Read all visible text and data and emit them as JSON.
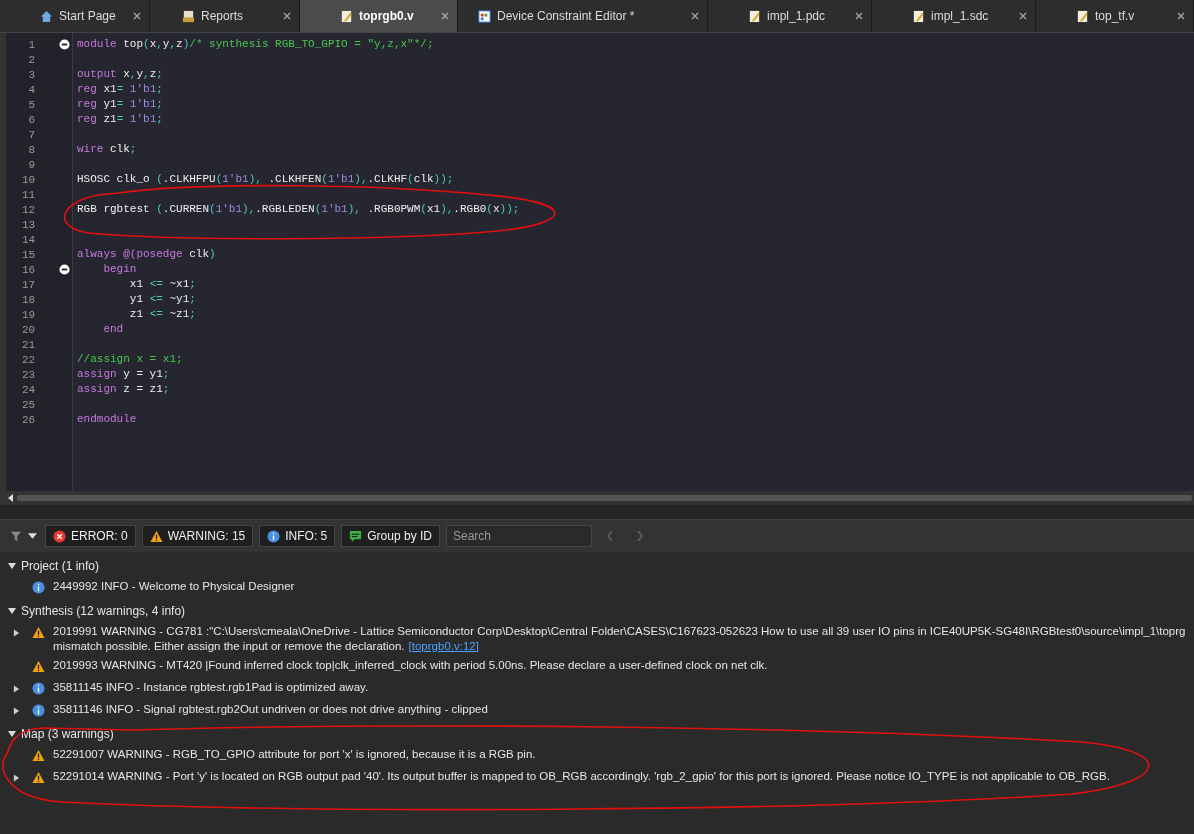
{
  "tabs": [
    {
      "label": "Start Page",
      "selected": false
    },
    {
      "label": "Reports",
      "selected": false
    },
    {
      "label": "toprgb0.v",
      "selected": true
    },
    {
      "label": "Device Constraint Editor *",
      "selected": false
    },
    {
      "label": "impl_1.pdc",
      "selected": false
    },
    {
      "label": "impl_1.sdc",
      "selected": false
    },
    {
      "label": "top_tf.v",
      "selected": false
    }
  ],
  "editor": {
    "lines": [
      {
        "number": "1",
        "fold": true,
        "tokens": [
          {
            "kind": "kw",
            "text": "module"
          },
          {
            "kind": "id",
            "text": " top"
          },
          {
            "kind": "op",
            "text": "("
          },
          {
            "kind": "id",
            "text": "x"
          },
          {
            "kind": "op",
            "text": ","
          },
          {
            "kind": "id",
            "text": "y"
          },
          {
            "kind": "op",
            "text": ","
          },
          {
            "kind": "id",
            "text": "z"
          },
          {
            "kind": "op",
            "text": ")"
          },
          {
            "kind": "cm",
            "text": "/* synthesis RGB_TO_GPIO = \"y,z,x\"*/;"
          }
        ]
      },
      {
        "number": "2",
        "fold": false
      },
      {
        "number": "3",
        "fold": false,
        "tokens": [
          {
            "kind": "kw",
            "text": "output"
          },
          {
            "kind": "id",
            "text": " x"
          },
          {
            "kind": "op",
            "text": ","
          },
          {
            "kind": "id",
            "text": "y"
          },
          {
            "kind": "op",
            "text": ","
          },
          {
            "kind": "id",
            "text": "z"
          },
          {
            "kind": "op",
            "text": ";"
          }
        ]
      },
      {
        "number": "4",
        "fold": false,
        "tokens": [
          {
            "kind": "kw",
            "text": "reg"
          },
          {
            "kind": "id",
            "text": " x1"
          },
          {
            "kind": "op",
            "text": "="
          },
          {
            "kind": "num",
            "text": " 1'b1"
          },
          {
            "kind": "op",
            "text": ";"
          }
        ]
      },
      {
        "number": "5",
        "fold": false,
        "tokens": [
          {
            "kind": "kw",
            "text": "reg"
          },
          {
            "kind": "id",
            "text": " y1"
          },
          {
            "kind": "op",
            "text": "="
          },
          {
            "kind": "num",
            "text": " 1'b1"
          },
          {
            "kind": "op",
            "text": ";"
          }
        ]
      },
      {
        "number": "6",
        "fold": false,
        "tokens": [
          {
            "kind": "kw",
            "text": "reg"
          },
          {
            "kind": "id",
            "text": " z1"
          },
          {
            "kind": "op",
            "text": "="
          },
          {
            "kind": "num",
            "text": " 1'b1"
          },
          {
            "kind": "op",
            "text": ";"
          }
        ]
      },
      {
        "number": "7",
        "fold": false
      },
      {
        "number": "8",
        "fold": false,
        "tokens": [
          {
            "kind": "kw",
            "text": "wire"
          },
          {
            "kind": "id",
            "text": " clk"
          },
          {
            "kind": "op",
            "text": ";"
          }
        ]
      },
      {
        "number": "9",
        "fold": false
      },
      {
        "number": "10",
        "fold": false,
        "tokens": [
          {
            "kind": "id",
            "text": "HSOSC clk_o "
          },
          {
            "kind": "op",
            "text": "("
          },
          {
            "kind": "id",
            "text": ".CLKHFPU"
          },
          {
            "kind": "op",
            "text": "("
          },
          {
            "kind": "num",
            "text": "1'b1"
          },
          {
            "kind": "op",
            "text": "),"
          },
          {
            "kind": "id",
            "text": " .CLKHFEN"
          },
          {
            "kind": "op",
            "text": "("
          },
          {
            "kind": "num",
            "text": "1'b1"
          },
          {
            "kind": "op",
            "text": "),"
          },
          {
            "kind": "id",
            "text": ".CLKHF"
          },
          {
            "kind": "op",
            "text": "("
          },
          {
            "kind": "id",
            "text": "clk"
          },
          {
            "kind": "op",
            "text": "));"
          }
        ]
      },
      {
        "number": "11",
        "fold": false
      },
      {
        "number": "12",
        "fold": false,
        "tokens": [
          {
            "kind": "id",
            "text": "RGB rgbtest "
          },
          {
            "kind": "op",
            "text": "("
          },
          {
            "kind": "id",
            "text": ".CURREN"
          },
          {
            "kind": "op",
            "text": "("
          },
          {
            "kind": "num",
            "text": "1'b1"
          },
          {
            "kind": "op",
            "text": "),"
          },
          {
            "kind": "id",
            "text": ".RGBLEDEN"
          },
          {
            "kind": "op",
            "text": "("
          },
          {
            "kind": "num",
            "text": "1'b1"
          },
          {
            "kind": "op",
            "text": "),"
          },
          {
            "kind": "id",
            "text": " .RGB0PWM"
          },
          {
            "kind": "op",
            "text": "("
          },
          {
            "kind": "id",
            "text": "x1"
          },
          {
            "kind": "op",
            "text": "),"
          },
          {
            "kind": "id",
            "text": ".RGB0"
          },
          {
            "kind": "op",
            "text": "("
          },
          {
            "kind": "id",
            "text": "x"
          },
          {
            "kind": "op",
            "text": "));"
          }
        ]
      },
      {
        "number": "13",
        "fold": false
      },
      {
        "number": "14",
        "fold": false
      },
      {
        "number": "15",
        "fold": false,
        "tokens": [
          {
            "kind": "kw",
            "text": "always @(posedge"
          },
          {
            "kind": "id",
            "text": " clk"
          },
          {
            "kind": "op",
            "text": ")"
          }
        ]
      },
      {
        "number": "16",
        "fold": true,
        "tokens": [
          {
            "kind": "kw",
            "text": "    begin"
          }
        ]
      },
      {
        "number": "17",
        "fold": false,
        "tokens": [
          {
            "kind": "id",
            "text": "        x1 "
          },
          {
            "kind": "op",
            "text": "<="
          },
          {
            "kind": "id",
            "text": " ~x1"
          },
          {
            "kind": "op",
            "text": ";"
          }
        ]
      },
      {
        "number": "18",
        "fold": false,
        "tokens": [
          {
            "kind": "id",
            "text": "        y1 "
          },
          {
            "kind": "op",
            "text": "<="
          },
          {
            "kind": "id",
            "text": " ~y1"
          },
          {
            "kind": "op",
            "text": ";"
          }
        ]
      },
      {
        "number": "19",
        "fold": false,
        "tokens": [
          {
            "kind": "id",
            "text": "        z1 "
          },
          {
            "kind": "op",
            "text": "<="
          },
          {
            "kind": "id",
            "text": " ~z1"
          },
          {
            "kind": "op",
            "text": ";"
          }
        ]
      },
      {
        "number": "20",
        "fold": false,
        "tokens": [
          {
            "kind": "kw",
            "text": "    end"
          }
        ]
      },
      {
        "number": "21",
        "fold": false
      },
      {
        "number": "22",
        "fold": false,
        "tokens": [
          {
            "kind": "cm",
            "text": "//assign x = x1;"
          }
        ]
      },
      {
        "number": "23",
        "fold": false,
        "tokens": [
          {
            "kind": "kw",
            "text": "assign"
          },
          {
            "kind": "id",
            "text": " y = y1"
          },
          {
            "kind": "op",
            "text": ";"
          }
        ]
      },
      {
        "number": "24",
        "fold": false,
        "tokens": [
          {
            "kind": "kw",
            "text": "assign"
          },
          {
            "kind": "id",
            "text": " z = z1"
          },
          {
            "kind": "op",
            "text": ";"
          }
        ]
      },
      {
        "number": "25",
        "fold": false
      },
      {
        "number": "26",
        "fold": false,
        "tokens": [
          {
            "kind": "kw",
            "text": "endmodule"
          }
        ]
      }
    ]
  },
  "toolbar": {
    "filters": [
      {
        "kind": "error",
        "label": "ERROR: 0"
      },
      {
        "kind": "warning",
        "label": "WARNING: 15"
      },
      {
        "kind": "info",
        "label": "INFO: 5"
      },
      {
        "kind": "group",
        "label": "Group by ID"
      }
    ],
    "search": {
      "placeholder": "Search"
    }
  },
  "groups": [
    {
      "title": "Project (1 info)",
      "expanded": true,
      "messages": [
        {
          "kind": "info",
          "expandable": false,
          "text": "2449992 INFO - Welcome to Physical Designer"
        }
      ]
    },
    {
      "title": "Synthesis (12 warnings, 4 info)",
      "expanded": true,
      "messages": [
        {
          "kind": "warning",
          "expandable": true,
          "text": "2019991 WARNING - CG781 :\"C:\\Users\\cmeala\\OneDrive - Lattice Semiconductor Corp\\Desktop\\Central Folder\\CASES\\C167623-052623 How to use all 39 user IO pins in ICE40UP5K-SG48I\\RGBtest0\\source\\impl_1\\toprg",
          "continuation": "mismatch possible. Either assign the input or remove the declaration.",
          "link": "[toprgb0.v:12]"
        },
        {
          "kind": "warning",
          "expandable": false,
          "text": "2019993 WARNING - MT420 |Found inferred clock top|clk_inferred_clock with period 5.00ns. Please declare a user-defined clock on net clk."
        },
        {
          "kind": "info",
          "expandable": true,
          "text": "35811145 INFO - Instance rgbtest.rgb1Pad is optimized away."
        },
        {
          "kind": "info",
          "expandable": true,
          "text": "35811146 INFO - Signal rgbtest.rgb2Out undriven or does not drive anything - clipped"
        }
      ]
    },
    {
      "title": "Map (3 warnings)",
      "expanded": true,
      "messages": [
        {
          "kind": "warning",
          "expandable": false,
          "text": "52291007 WARNING - RGB_TO_GPIO attribute for port 'x' is ignored, because it is a RGB pin."
        },
        {
          "kind": "warning",
          "expandable": true,
          "text": "52291014 WARNING - Port 'y' is located on RGB output pad '40'. Its output buffer is mapped to OB_RGB accordingly. 'rgb_2_gpio' for this port is ignored. Please notice IO_TYPE is not applicable to OB_RGB."
        }
      ]
    }
  ]
}
